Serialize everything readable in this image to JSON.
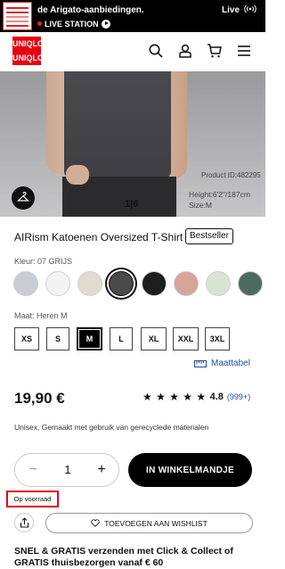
{
  "banner": {
    "headline": "de Arigato-aanbiedingen.",
    "live_right": "Live",
    "badge": "LIVE STATION",
    "thumb_icon": "live-promo-thumbnail",
    "wifi_icon": "broadcast-icon"
  },
  "header": {
    "logo_top_left": "UNI",
    "logo_top_right": "QLO",
    "logo_bottom_left": "UNI",
    "logo_bottom_right": "QLO",
    "icons": [
      "search-icon",
      "user-icon",
      "cart-icon",
      "menu-icon"
    ]
  },
  "hero": {
    "pager": "1|6",
    "product_id": "Product ID:482295",
    "model_height": "Height:6'2\"/187cm",
    "model_size": "Size:M",
    "zoom_icon": "hanger-icon"
  },
  "product": {
    "title": "AIRism Katoenen Oversized T-Shirt",
    "badge": "Bestseller",
    "color_label": "Kleur: 07 GRIJS",
    "colors": [
      {
        "hex": "#c9ccd6"
      },
      {
        "hex": "#f3f3f3"
      },
      {
        "hex": "#e3d9cf"
      },
      {
        "hex": "#4a4a4c",
        "selected": true
      },
      {
        "hex": "#1e1e20"
      },
      {
        "hex": "#d7a49a"
      },
      {
        "hex": "#d8e4d2"
      },
      {
        "hex": "#4d6a62"
      }
    ],
    "size_label": "Maat: Heren M",
    "sizes": [
      "XS",
      "S",
      "M",
      "L",
      "XL",
      "XXL",
      "3XL"
    ],
    "selected_size": "M",
    "size_guide": "Maattabel",
    "price": "19,90 €",
    "rating": {
      "stars": 5,
      "score": "4.8",
      "count": "(999+)"
    },
    "description": "Unisex,  Gemaakt met gebruik van gerecyclede materialen"
  },
  "purchase": {
    "quantity": "1",
    "minus": "−",
    "plus": "+",
    "cart_label": "IN WINKELMANDJE",
    "stock": "Op voorraad",
    "wishlist_label": "TOEVOEGEN AAN WISHLIST",
    "shipping_line1": "SNEL & GRATIS verzenden met Click & Collect of",
    "shipping_line2": "GRATIS thuisbezorgen vanaf € 60"
  },
  "colors": {
    "brand": "#e60012",
    "link": "#1b4fa0"
  }
}
